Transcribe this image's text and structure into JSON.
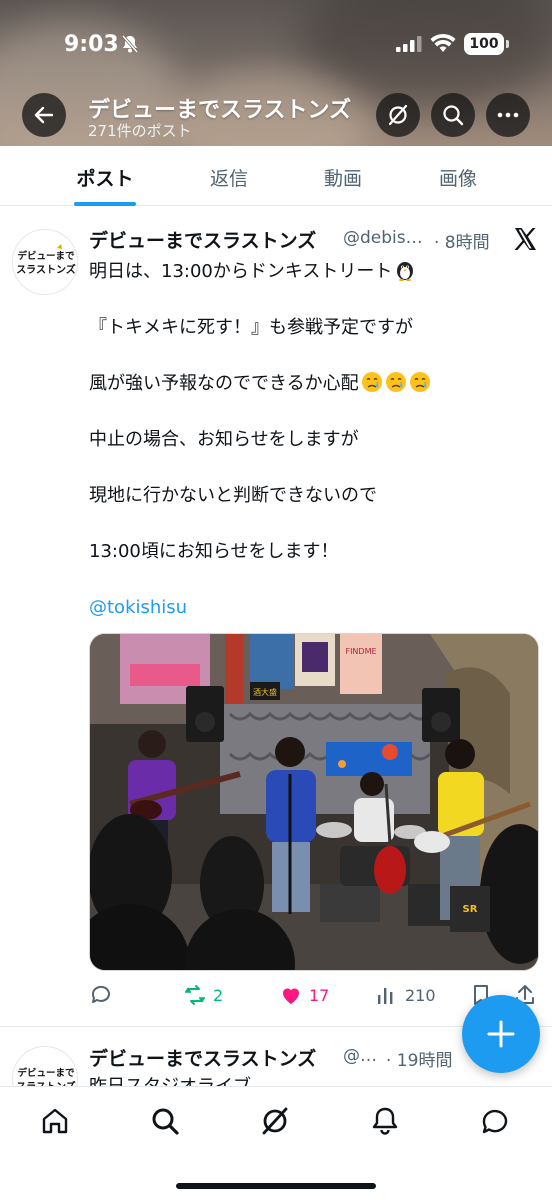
{
  "status_bar": {
    "time": "9:03",
    "battery": "100"
  },
  "profile": {
    "name": "デビューまでスラストンズ",
    "post_count": "271件のポスト"
  },
  "tabs": [
    {
      "label": "ポスト",
      "active": true
    },
    {
      "label": "返信",
      "active": false
    },
    {
      "label": "動画",
      "active": false
    },
    {
      "label": "画像",
      "active": false
    }
  ],
  "post": {
    "author": "デビューまでスラストンズ",
    "handle": "@debis…",
    "time": "· 8時間",
    "lines": [
      "明日は、13:00からドンキストリート",
      "『トキメキに死す！』も参戦予定ですが",
      "風が強い予報なのでできるか心配",
      "中止の場合、お知らせをしますが",
      "現地に行かないと判断できないので",
      "13:00頃にお知らせをします！"
    ],
    "mention": "@tokishisu",
    "stats": {
      "retweets": "2",
      "likes": "17",
      "views": "210"
    },
    "media_texts": {
      "poster_sign": "FINDME",
      "banner": "酒大盛"
    }
  },
  "post2": {
    "author": "デビューまでスラストンズ",
    "handle": "@…",
    "time": "· 19時間",
    "preview": "昨日スタジオライブ"
  },
  "avatar_logo": {
    "line1": "デビューまで",
    "line2": "スラストンズ"
  },
  "colors": {
    "accent": "#1d9bf0",
    "retweet": "#00ba7c",
    "like": "#f91880",
    "text": "#0f1419",
    "muted": "#536471"
  },
  "icons": [
    "back-arrow-icon",
    "grok-icon",
    "search-icon",
    "more-icon",
    "x-logo-icon",
    "reply-icon",
    "retweet-icon",
    "heart-icon",
    "views-icon",
    "bookmark-icon",
    "share-icon",
    "compose-plus-icon",
    "home-icon",
    "explore-icon",
    "notifications-icon",
    "messages-icon"
  ]
}
